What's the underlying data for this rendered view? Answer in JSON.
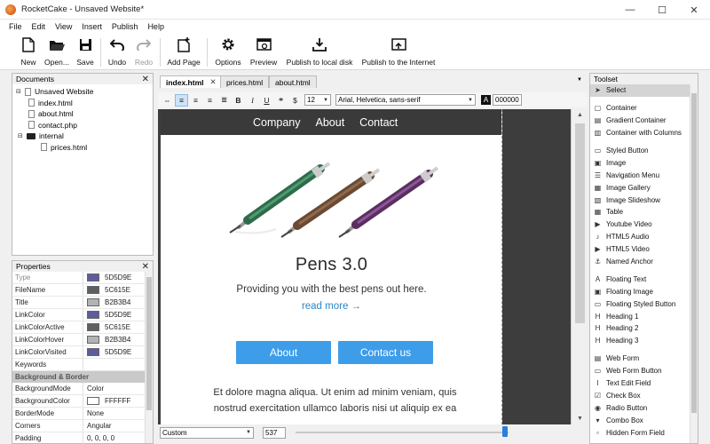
{
  "window": {
    "title": "RocketCake - Unsaved Website*",
    "controls": [
      "—",
      "☐",
      "✕"
    ]
  },
  "menu": [
    "File",
    "Edit",
    "View",
    "Insert",
    "Publish",
    "Help"
  ],
  "toolbar": {
    "new": "New",
    "open": "Open...",
    "save": "Save",
    "undo": "Undo",
    "redo": "Redo",
    "add_page": "Add Page",
    "options": "Options",
    "preview": "Preview",
    "publish_local": "Publish to local disk",
    "publish_internet": "Publish to the Internet"
  },
  "documents": {
    "title": "Documents",
    "tree": [
      {
        "label": "Unsaved Website",
        "type": "root"
      },
      {
        "label": "index.html",
        "type": "file"
      },
      {
        "label": "about.html",
        "type": "file"
      },
      {
        "label": "contact.php",
        "type": "file"
      },
      {
        "label": "internal",
        "type": "folder"
      },
      {
        "label": "prices.html",
        "type": "file"
      }
    ]
  },
  "properties": {
    "title": "Properties",
    "rows": [
      {
        "name": "Type",
        "value": "5D5D9E",
        "color": "#5D5D9E",
        "dim": true
      },
      {
        "name": "FileName",
        "value": "5C615E",
        "color": "#5C615E"
      },
      {
        "name": "Title",
        "value": "B2B3B4",
        "color": "#B2B3B4"
      },
      {
        "name": "LinkColor",
        "value": "5D5D9E",
        "color": "#5D5D9E"
      },
      {
        "name": "LinkColorActive",
        "value": "5C615E",
        "color": "#5C615E"
      },
      {
        "name": "LinkColorHover",
        "value": "B2B3B4",
        "color": "#B2B3B4"
      },
      {
        "name": "LinkColorVisited",
        "value": "5D5D9E",
        "color": "#5D5D9E"
      },
      {
        "name": "Keywords",
        "value": ""
      }
    ],
    "section": "Background & Border",
    "rows2": [
      {
        "name": "BackgroundMode",
        "value": "Color"
      },
      {
        "name": "BackgroundColor",
        "value": "FFFFFF",
        "color": "#FFFFFF"
      },
      {
        "name": "BorderMode",
        "value": "None"
      },
      {
        "name": "Corners",
        "value": "Angular"
      },
      {
        "name": "Padding",
        "value": "0, 0, 0, 0"
      }
    ]
  },
  "tabs": [
    {
      "label": "index.html",
      "active": true,
      "close": "✕"
    },
    {
      "label": "prices.html"
    },
    {
      "label": "about.html"
    }
  ],
  "format_bar": {
    "font_size": "12",
    "font_family": "Arial, Helvetica, sans-serif",
    "color_label": "A",
    "color_value": "000000"
  },
  "page": {
    "nav": [
      "Company",
      "About",
      "Contact"
    ],
    "title": "Pens 3.0",
    "subtitle": "Providing you with the best pens out here.",
    "link": "read more →",
    "buttons": [
      "About",
      "Contact us"
    ],
    "body_line1": "Et dolore magna aliqua. Ut enim ad minim veniam, quis",
    "body_line2": "nostrud exercitation ullamco laboris nisi ut aliquip ex ea"
  },
  "bottom_bar": {
    "preset": "Custom",
    "width": "537"
  },
  "toolset": {
    "title": "Toolset",
    "groups": [
      [
        {
          "label": "Select",
          "icon": "pointer-icon",
          "selected": true
        }
      ],
      [
        {
          "label": "Container",
          "icon": "container-icon"
        },
        {
          "label": "Gradient Container",
          "icon": "gradient-icon"
        },
        {
          "label": "Container with Columns",
          "icon": "columns-icon"
        }
      ],
      [
        {
          "label": "Styled Button",
          "icon": "button-icon"
        },
        {
          "label": "Image",
          "icon": "image-icon"
        },
        {
          "label": "Navigation Menu",
          "icon": "menu-icon"
        },
        {
          "label": "Image Gallery",
          "icon": "gallery-icon"
        },
        {
          "label": "Image Slideshow",
          "icon": "slideshow-icon"
        },
        {
          "label": "Table",
          "icon": "table-icon"
        },
        {
          "label": "Youtube Video",
          "icon": "youtube-icon"
        },
        {
          "label": "HTML5 Audio",
          "icon": "audio-icon"
        },
        {
          "label": "HTML5 Video",
          "icon": "video-icon"
        },
        {
          "label": "Named Anchor",
          "icon": "anchor-icon"
        }
      ],
      [
        {
          "label": "Floating Text",
          "icon": "text-icon"
        },
        {
          "label": "Floating Image",
          "icon": "image-icon"
        },
        {
          "label": "Floating Styled Button",
          "icon": "button-icon"
        },
        {
          "label": "Heading 1",
          "icon": "heading-icon"
        },
        {
          "label": "Heading 2",
          "icon": "heading-icon"
        },
        {
          "label": "Heading 3",
          "icon": "heading-icon"
        }
      ],
      [
        {
          "label": "Web Form",
          "icon": "form-icon"
        },
        {
          "label": "Web Form Button",
          "icon": "button-icon"
        },
        {
          "label": "Text Edit Field",
          "icon": "textfield-icon"
        },
        {
          "label": "Check Box",
          "icon": "checkbox-icon"
        },
        {
          "label": "Radio Button",
          "icon": "radio-icon"
        },
        {
          "label": "Combo Box",
          "icon": "combobox-icon"
        },
        {
          "label": "Hidden Form Field",
          "icon": "hidden-icon"
        }
      ]
    ]
  },
  "colors": {
    "accent": "#3e9de8",
    "link": "#2e86c8",
    "nav_bg": "#3a3a3a",
    "canvas_bg": "#3d3d3d"
  }
}
